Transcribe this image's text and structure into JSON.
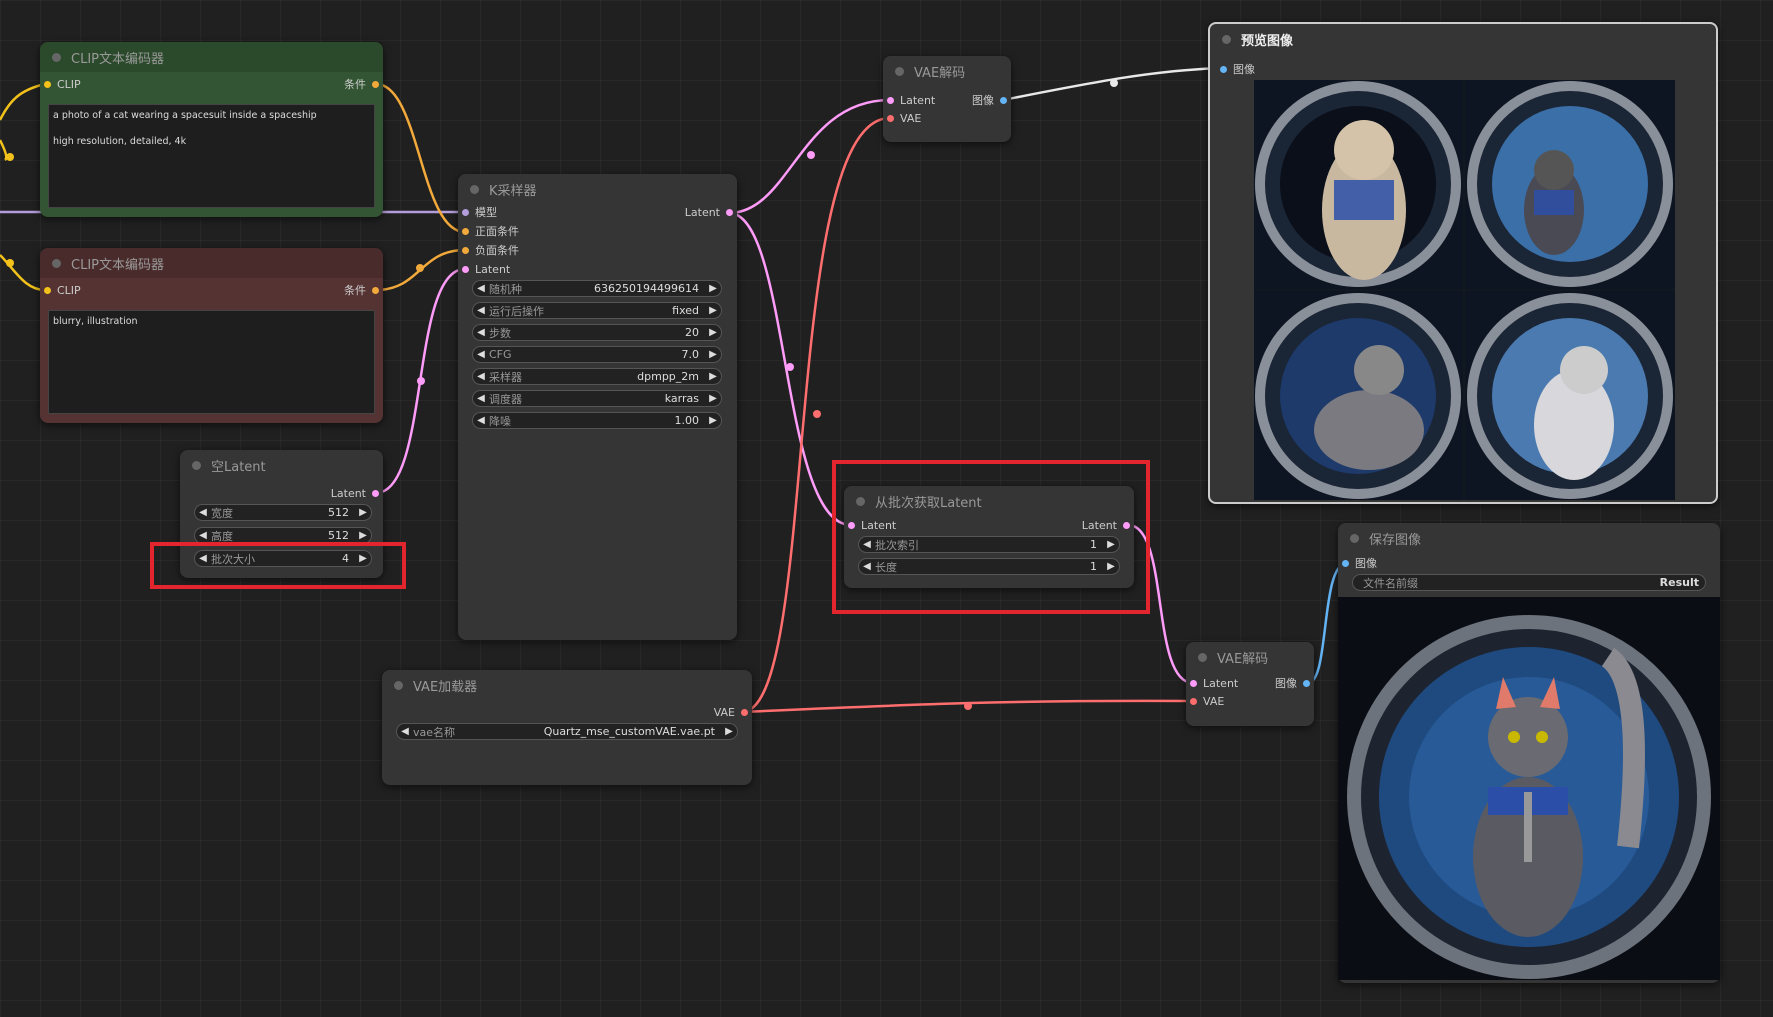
{
  "colors": {
    "clip": "#f2c21b",
    "conditioning": "#f2a93b",
    "latent": "#ff9cf9",
    "vae": "#ff6e6e",
    "image": "#64b5f6",
    "model": "#b39ddb"
  },
  "clip_pos": {
    "title": "CLIP文本编码器",
    "in_label": "CLIP",
    "out_label": "条件",
    "text": "a photo of a cat wearing a spacesuit inside a spaceship\n\nhigh resolution, detailed, 4k"
  },
  "clip_neg": {
    "title": "CLIP文本编码器",
    "in_label": "CLIP",
    "out_label": "条件",
    "text": "blurry, illustration"
  },
  "empty_latent": {
    "title": "空Latent",
    "out_label": "Latent",
    "widgets": [
      {
        "label": "宽度",
        "value": "512"
      },
      {
        "label": "高度",
        "value": "512"
      },
      {
        "label": "批次大小",
        "value": "4"
      }
    ]
  },
  "ksampler": {
    "title": "K采样器",
    "inputs": [
      "模型",
      "正面条件",
      "负面条件",
      "Latent"
    ],
    "out_label": "Latent",
    "widgets": [
      {
        "label": "随机种",
        "value": "636250194499614"
      },
      {
        "label": "运行后操作",
        "value": "fixed"
      },
      {
        "label": "步数",
        "value": "20"
      },
      {
        "label": "CFG",
        "value": "7.0"
      },
      {
        "label": "采样器",
        "value": "dpmpp_2m"
      },
      {
        "label": "调度器",
        "value": "karras"
      },
      {
        "label": "降噪",
        "value": "1.00"
      }
    ]
  },
  "vae_decode_1": {
    "title": "VAE解码",
    "in1": "Latent",
    "in2": "VAE",
    "out_label": "图像"
  },
  "preview": {
    "title": "预览图像",
    "in_label": "图像"
  },
  "latent_from_batch": {
    "title": "从批次获取Latent",
    "in_label": "Latent",
    "out_label": "Latent",
    "widgets": [
      {
        "label": "批次索引",
        "value": "1"
      },
      {
        "label": "长度",
        "value": "1"
      }
    ]
  },
  "vae_loader": {
    "title": "VAE加载器",
    "out_label": "VAE",
    "widget": {
      "label": "vae名称",
      "value": "Quartz_mse_customVAE.vae.pt"
    }
  },
  "vae_decode_2": {
    "title": "VAE解码",
    "in1": "Latent",
    "in2": "VAE",
    "out_label": "图像"
  },
  "save": {
    "title": "保存图像",
    "in_label": "图像",
    "widget": {
      "label": "文件名前缀",
      "value": "Result"
    }
  }
}
